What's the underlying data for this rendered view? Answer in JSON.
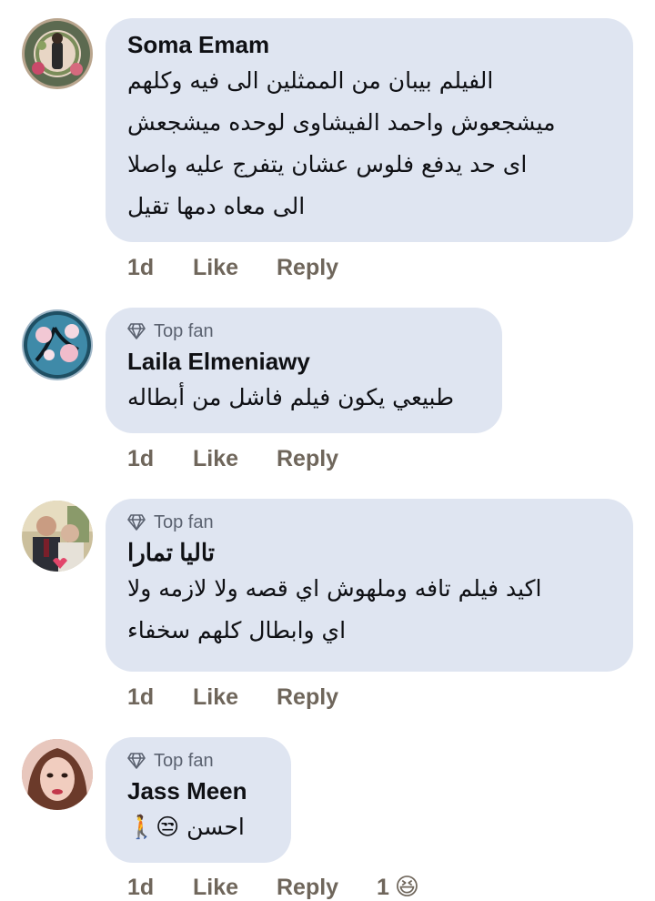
{
  "comments": [
    {
      "author": "Soma Emam",
      "top_fan": false,
      "lines": [
        "الفيلم بيبان من الممثلين الى فيه وكلهم",
        "ميشجعوش واحمد الفيشاوى لوحده ميشجعش",
        "اى حد يدفع فلوس عشان يتفرج عليه واصلا",
        "الى معاه دمها تقيل"
      ],
      "time": "1d",
      "like": "Like",
      "reply": "Reply"
    },
    {
      "author": "Laila Elmeniawy",
      "top_fan": true,
      "badge": "Top fan",
      "lines": [
        "طبيعي يكون فيلم فاشل من أبطاله"
      ],
      "time": "1d",
      "like": "Like",
      "reply": "Reply"
    },
    {
      "author": "تاليا تمارا",
      "top_fan": true,
      "badge": "Top fan",
      "lines": [
        "اكيد فيلم تافه وملهوش اي قصه ولا لازمه ولا",
        "اي وابطال كلهم سخفاء"
      ],
      "time": "1d",
      "like": "Like",
      "reply": "Reply"
    },
    {
      "author": "Jass Meen",
      "top_fan": true,
      "badge": "Top fan",
      "lines": [
        "احسن 😒🚶"
      ],
      "time": "1d",
      "like": "Like",
      "reply": "Reply",
      "reaction_count": "1",
      "reaction_emoji": "😆"
    }
  ],
  "icons": {
    "badge": "diamond-icon",
    "avatar": "avatar"
  },
  "colors": {
    "bubble": "#dfe5f1",
    "action_text": "#6f665b",
    "badge_text": "#5b6270",
    "name_text": "#0f1014"
  }
}
